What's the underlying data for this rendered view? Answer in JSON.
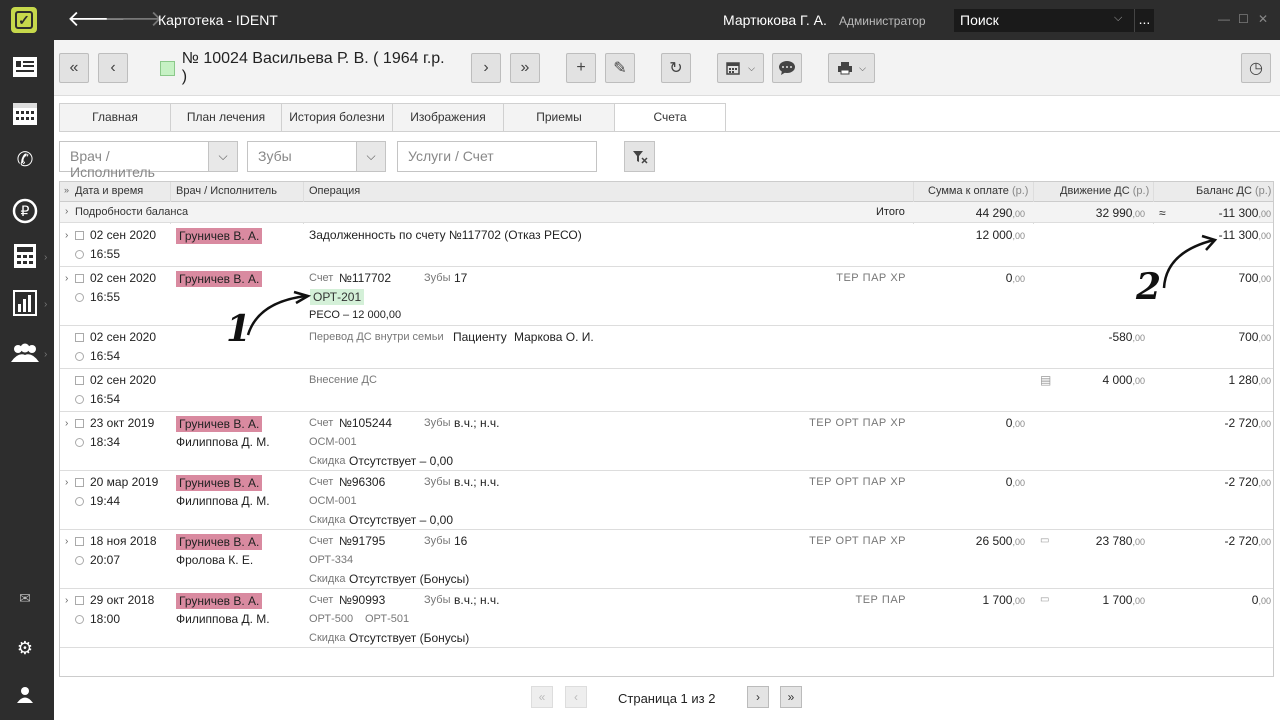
{
  "app": {
    "title": "Картотека - IDENT"
  },
  "user": {
    "name": "Мартюкова Г. А.",
    "role": "Администратор"
  },
  "search": {
    "placeholder": "Поиск",
    "more": "..."
  },
  "patient": {
    "title": "№ 10024 Васильева Р. В. ( 1964 г.р. )"
  },
  "tabs": [
    {
      "label": "Главная"
    },
    {
      "label": "План лечения"
    },
    {
      "label": "История болезни"
    },
    {
      "label": "Изображения"
    },
    {
      "label": "Приемы"
    },
    {
      "label": "Счета",
      "active": true
    }
  ],
  "filters": {
    "doctor_placeholder": "Врач / Исполнитель",
    "teeth_placeholder": "Зубы",
    "services_placeholder": "Услуги / Счет"
  },
  "grid": {
    "headers": {
      "datetime": "Дата и время",
      "doctor": "Врач / Исполнитель",
      "operation": "Операция",
      "sum": "Сумма к оплате",
      "movement": "Движение ДС",
      "balance": "Баланс ДС",
      "unit": "(р.)"
    },
    "summary": {
      "label": "Подробности баланса",
      "total_label": "Итого",
      "sum": "44 290",
      "sum_dec": ",00",
      "movement": "32 990",
      "movement_dec": ",00",
      "approx": "≈",
      "balance": "-11 300",
      "balance_dec": ",00"
    },
    "rows": [
      {
        "date": "02 сен 2020",
        "time": "16:55",
        "doctor": "Груничев В. А.",
        "op": "Задолженность по счету №117702 (Отказ РЕСО)",
        "sum": "12 000",
        "sum_dec": ",00",
        "balance": "-11 300",
        "balance_dec": ",00"
      },
      {
        "date": "02 сен 2020",
        "time": "16:55",
        "doctor": "Груничев В. А.",
        "account_label": "Счет",
        "account_no": "№117702",
        "teeth_label": "Зубы",
        "teeth": "17",
        "tags": "ТЕР ПАР ХР",
        "code": "ОРТ-201",
        "insurer": "РЕСО – 12 000,00",
        "sum": "0",
        "sum_dec": ",00",
        "balance": "700",
        "balance_dec": ",00"
      },
      {
        "date": "02 сен 2020",
        "time": "16:54",
        "op_label": "Перевод ДС внутри семьи",
        "op_to": "Пациенту",
        "op_name": "Маркова О. И.",
        "movement": "-580",
        "movement_dec": ",00",
        "balance": "700",
        "balance_dec": ",00"
      },
      {
        "date": "02 сен 2020",
        "time": "16:54",
        "op_label": "Внесение ДС",
        "movement": "4 000",
        "movement_dec": ",00",
        "balance": "1 280",
        "balance_dec": ",00"
      },
      {
        "date": "23 окт 2019",
        "time": "18:34",
        "doctor": "Груничев В. А.",
        "doctor2": "Филиппова Д. М.",
        "account_label": "Счет",
        "account_no": "№105244",
        "teeth_label": "Зубы",
        "teeth": "в.ч.; н.ч.",
        "tags": "ТЕР ОРТ ПАР ХР",
        "code": "ОСМ-001",
        "discount_label": "Скидка",
        "discount": "Отсутствует – 0,00",
        "sum": "0",
        "sum_dec": ",00",
        "balance": "-2 720",
        "balance_dec": ",00"
      },
      {
        "date": "20 мар 2019",
        "time": "19:44",
        "doctor": "Груничев В. А.",
        "doctor2": "Филиппова Д. М.",
        "account_label": "Счет",
        "account_no": "№96306",
        "teeth_label": "Зубы",
        "teeth": "в.ч.; н.ч.",
        "tags": "ТЕР ОРТ ПАР ХР",
        "code": "ОСМ-001",
        "discount_label": "Скидка",
        "discount": "Отсутствует – 0,00",
        "sum": "0",
        "sum_dec": ",00",
        "balance": "-2 720",
        "balance_dec": ",00"
      },
      {
        "date": "18 ноя 2018",
        "time": "20:07",
        "doctor": "Груничев В. А.",
        "doctor2": "Фролова К. Е.",
        "account_label": "Счет",
        "account_no": "№91795",
        "teeth_label": "Зубы",
        "teeth": "16",
        "tags": "ТЕР ОРТ ПАР ХР",
        "code": "ОРТ-334",
        "discount_label": "Скидка",
        "discount": "Отсутствует (Бонусы)",
        "sum": "26 500",
        "sum_dec": ",00",
        "movement": "23 780",
        "movement_dec": ",00",
        "balance": "-2 720",
        "balance_dec": ",00"
      },
      {
        "date": "29 окт 2018",
        "time": "18:00",
        "doctor": "Груничев В. А.",
        "doctor2": "Филиппова Д. М.",
        "account_label": "Счет",
        "account_no": "№90993",
        "teeth_label": "Зубы",
        "teeth": "в.ч.; н.ч.",
        "tags": "ТЕР ПАР",
        "code": "ОРТ-500",
        "code2": "ОРТ-501",
        "discount_label": "Скидка",
        "discount": "Отсутствует (Бонусы)",
        "sum": "1 700",
        "sum_dec": ",00",
        "movement": "1 700",
        "movement_dec": ",00",
        "balance": "0",
        "balance_dec": ",00"
      }
    ]
  },
  "pager": {
    "label": "Страница",
    "page": "1",
    "of": "из",
    "total": "2"
  },
  "annotations": {
    "one": "1",
    "two": "2"
  }
}
